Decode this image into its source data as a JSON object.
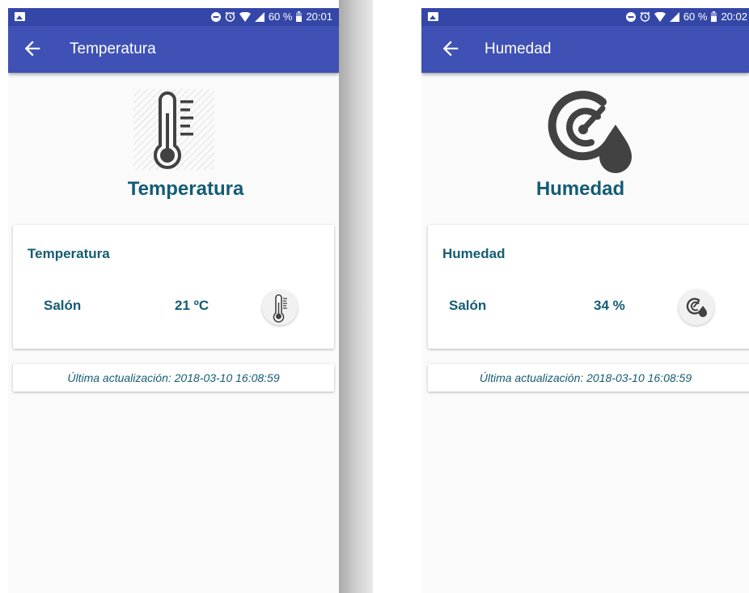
{
  "screens": [
    {
      "status_time": "20:01",
      "battery_percent": "60 %",
      "title": "Temperatura",
      "hero_label": "Temperatura",
      "hero_icon": "thermometer-icon",
      "card_title": "Temperatura",
      "row_label": "Salón",
      "row_value": "21 ºC",
      "last_update": "Última actualización: 2018-03-10 16:08:59"
    },
    {
      "status_time": "20:02",
      "battery_percent": "60 %",
      "title": "Humedad",
      "hero_label": "Humedad",
      "hero_icon": "humidity-gauge-icon",
      "card_title": "Humedad",
      "row_label": "Salón",
      "row_value": "34 %",
      "last_update": "Última actualización: 2018-03-10 16:08:59"
    }
  ],
  "colors": {
    "appbar": "#3f51b5",
    "statusbar": "#3447a8",
    "text_primary": "#145c74",
    "icon": "#424242"
  }
}
